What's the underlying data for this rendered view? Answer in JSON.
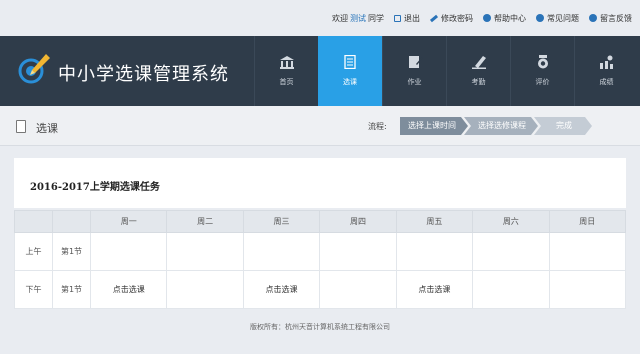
{
  "topbar": {
    "welcome": "欢迎",
    "username": "测试",
    "classmate": "同学",
    "logout": "退出",
    "change_password": "修改密码",
    "help_center": "帮助中心",
    "faq": "常见问题",
    "feedback": "留言反馈"
  },
  "app": {
    "title": "中小学选课管理系统"
  },
  "nav": {
    "items": [
      {
        "label": "首页",
        "icon": "home-icon"
      },
      {
        "label": "选课",
        "icon": "document-icon"
      },
      {
        "label": "作业",
        "icon": "edit-icon"
      },
      {
        "label": "考勤",
        "icon": "pen-icon"
      },
      {
        "label": "评价",
        "icon": "medal-icon"
      },
      {
        "label": "成绩",
        "icon": "chart-icon"
      }
    ],
    "active_index": 1
  },
  "crumb": {
    "page_title": "选课",
    "flow_label": "流程:",
    "steps": [
      "选择上课时间",
      "选择选修课程",
      "完成"
    ]
  },
  "task": {
    "title": "2016-2017上学期选课任务"
  },
  "schedule": {
    "days": [
      "周一",
      "周二",
      "周三",
      "周四",
      "周五",
      "周六",
      "周日"
    ],
    "rows": [
      {
        "period": "上午",
        "slot": "第1节",
        "cells": [
          "",
          "",
          "",
          "",
          "",
          "",
          ""
        ]
      },
      {
        "period": "下午",
        "slot": "第1节",
        "cells": [
          "点击选课",
          "",
          "点击选课",
          "",
          "点击选课",
          "",
          ""
        ]
      }
    ]
  },
  "footer": {
    "copyright": "版权所有：杭州天音计算机系统工程有限公司"
  },
  "colors": {
    "header_bg": "#2f3c4a",
    "active_nav": "#29a0e6",
    "link": "#1f6fb8"
  }
}
